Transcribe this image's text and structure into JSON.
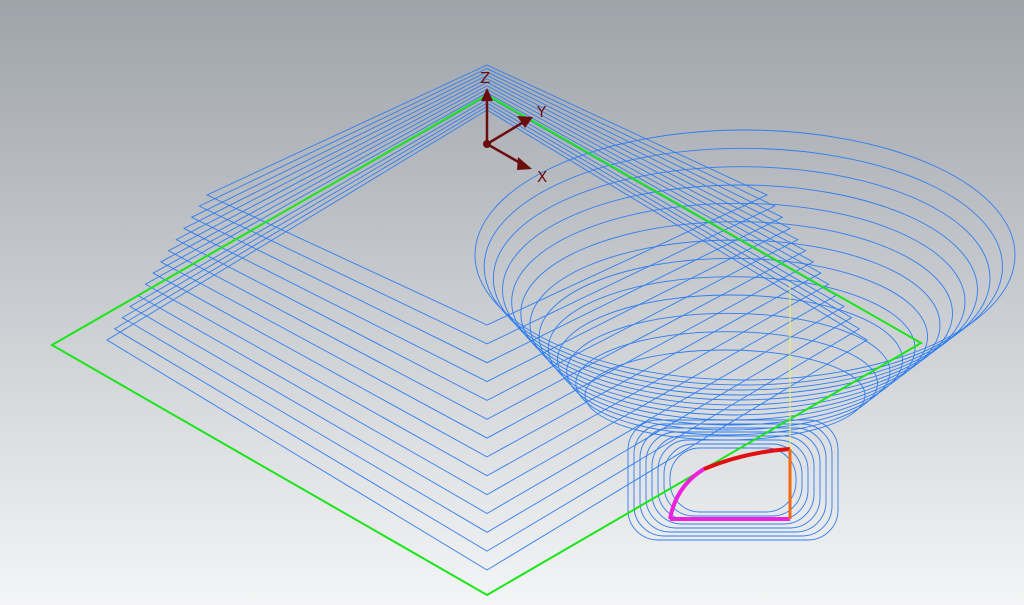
{
  "viewport": {
    "background_top": "#9ea3aa",
    "background_bottom": "#f4f5f6"
  },
  "colors": {
    "toolpath": "#2f7df0",
    "stock_boundary": "#19e619",
    "triad": "#6b0d0d",
    "arc_red": "#e01010",
    "line_orange": "#f06a12",
    "line_magenta": "#ee22dd",
    "guide_yellow": "#f2f060"
  },
  "triad": {
    "x_label": "X",
    "y_label": "Y",
    "z_label": "Z"
  },
  "icons": {
    "triad": "coordinate-triad-icon"
  }
}
